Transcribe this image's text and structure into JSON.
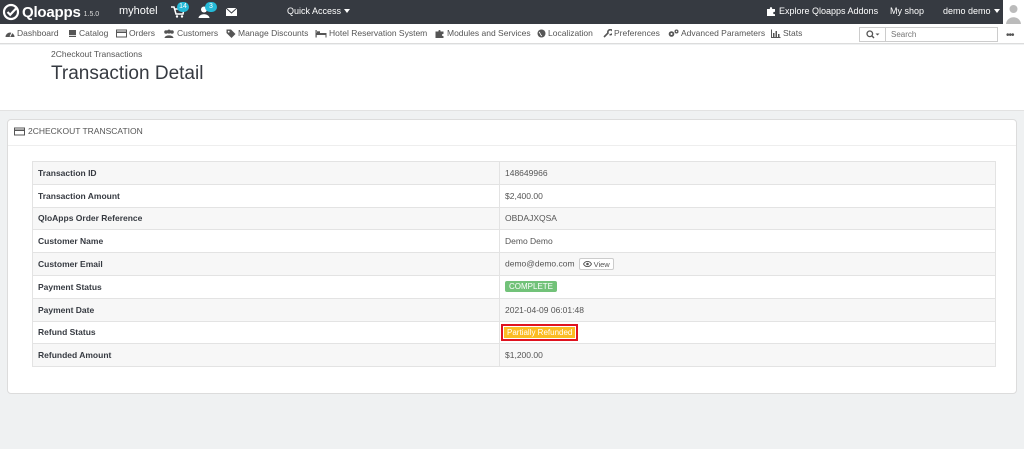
{
  "header": {
    "brand": "Qloapps",
    "version": "1.5.0",
    "shop_name": "myhotel",
    "cart_badge": "14",
    "customers_badge": "3",
    "quick_access": "Quick Access",
    "explore": "Explore Qloapps Addons",
    "my_shop": "My shop",
    "user": "demo demo"
  },
  "nav": {
    "items": [
      {
        "label": "Dashboard",
        "icon": "dashboard-icon"
      },
      {
        "label": "Catalog",
        "icon": "book-icon"
      },
      {
        "label": "Orders",
        "icon": "credit-card-icon"
      },
      {
        "label": "Customers",
        "icon": "users-icon"
      },
      {
        "label": "Manage Discounts",
        "icon": "tag-icon"
      },
      {
        "label": "Hotel Reservation System",
        "icon": "bed-icon"
      },
      {
        "label": "Modules and Services",
        "icon": "puzzle-icon"
      },
      {
        "label": "Localization",
        "icon": "globe-icon"
      },
      {
        "label": "Preferences",
        "icon": "wrench-icon"
      },
      {
        "label": "Advanced Parameters",
        "icon": "cogs-icon"
      },
      {
        "label": "Stats",
        "icon": "bar-chart-icon"
      }
    ],
    "search_placeholder": "Search"
  },
  "page": {
    "breadcrumb": "2Checkout Transactions",
    "title": "Transaction Detail"
  },
  "panel": {
    "heading": "2CHECKOUT TRANSCATION",
    "rows": [
      {
        "label": "Transaction ID",
        "value": "148649966"
      },
      {
        "label": "Transaction Amount",
        "value": "$2,400.00"
      },
      {
        "label": "QloApps Order Reference",
        "value": "OBDAJXQSA"
      },
      {
        "label": "Customer Name",
        "value": "Demo Demo"
      },
      {
        "label": "Customer Email",
        "value": "demo@demo.com",
        "action": "View"
      },
      {
        "label": "Payment Status",
        "value": "COMPLETE"
      },
      {
        "label": "Payment Date",
        "value": "2021-04-09 06:01:48"
      },
      {
        "label": "Refund Status",
        "value": "Partially Refunded"
      },
      {
        "label": "Refunded Amount",
        "value": "$1,200.00"
      }
    ]
  },
  "colors": {
    "topbar": "#363a41",
    "badge": "#25b9d7",
    "complete": "#72c279",
    "partial": "#fbbb22",
    "highlight": "#e0131f"
  }
}
